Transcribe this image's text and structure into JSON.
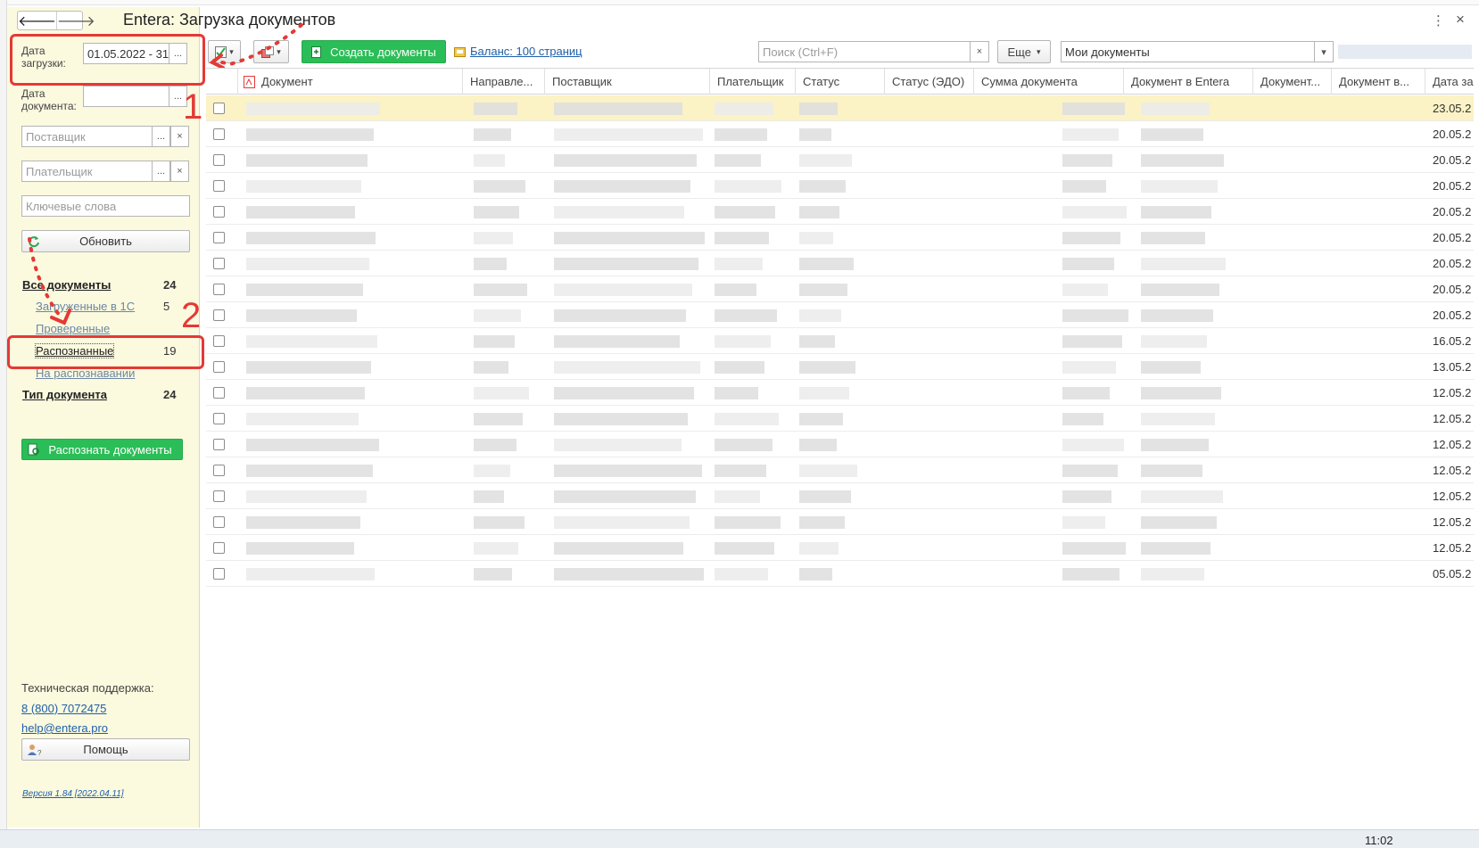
{
  "window": {
    "title": "Entera: Загрузка документов",
    "back_arrow": "🡐",
    "forward_arrow": "🡒",
    "more_icon": "⋮",
    "close_icon": "×"
  },
  "filters": {
    "upload_date_label": "Дата загрузки:",
    "upload_date_value": "01.05.2022 - 31",
    "doc_date_label": "Дата документа:",
    "doc_date_value": "",
    "supplier_placeholder": "Поставщик",
    "payer_placeholder": "Плательщик",
    "keywords_placeholder": "Ключевые слова",
    "select_btn": "...",
    "clear_btn": "×",
    "refresh_label": "Обновить"
  },
  "nav": {
    "all_docs": {
      "label": "Все документы",
      "count": "24"
    },
    "loaded_1c": {
      "label": "Загруженные в 1С",
      "count": "5"
    },
    "checked": {
      "label": "Проверенные"
    },
    "recognized": {
      "label": "Распознанные",
      "count": "19"
    },
    "recognizing": {
      "label": "На распознавании"
    },
    "doc_type": {
      "label": "Тип документа",
      "count": "24"
    }
  },
  "recognize_btn": "Распознать документы",
  "support": {
    "label": "Техническая поддержка:",
    "phone": "8 (800) 7072475",
    "email": "help@entera.pro",
    "help_btn": "Помощь",
    "version": "Версия 1.84 [2022.04.11]"
  },
  "toolbar": {
    "create_docs": "Создать документы",
    "balance": "Баланс: 100 страниц",
    "search_placeholder": "Поиск (Ctrl+F)",
    "more_btn": "Еще",
    "view_select": "Мои документы",
    "dropdown_arrow": "▾"
  },
  "annotations": {
    "one": "1",
    "two": "2"
  },
  "table": {
    "columns": [
      "Документ",
      "Направле...",
      "Поставщик",
      "Плательщик",
      "Статус",
      "Статус (ЭДО)",
      "Сумма документа",
      "Документ в Entera",
      "Документ...",
      "Документ в...",
      "Дата за"
    ],
    "dates": [
      "23.05.2",
      "20.05.2",
      "20.05.2",
      "20.05.2",
      "20.05.2",
      "20.05.2",
      "20.05.2",
      "20.05.2",
      "20.05.2",
      "16.05.2",
      "13.05.2",
      "12.05.2",
      "12.05.2",
      "12.05.2",
      "12.05.2",
      "12.05.2",
      "12.05.2",
      "12.05.2",
      "05.05.2"
    ]
  },
  "taskbar": {
    "time": "11:02"
  }
}
